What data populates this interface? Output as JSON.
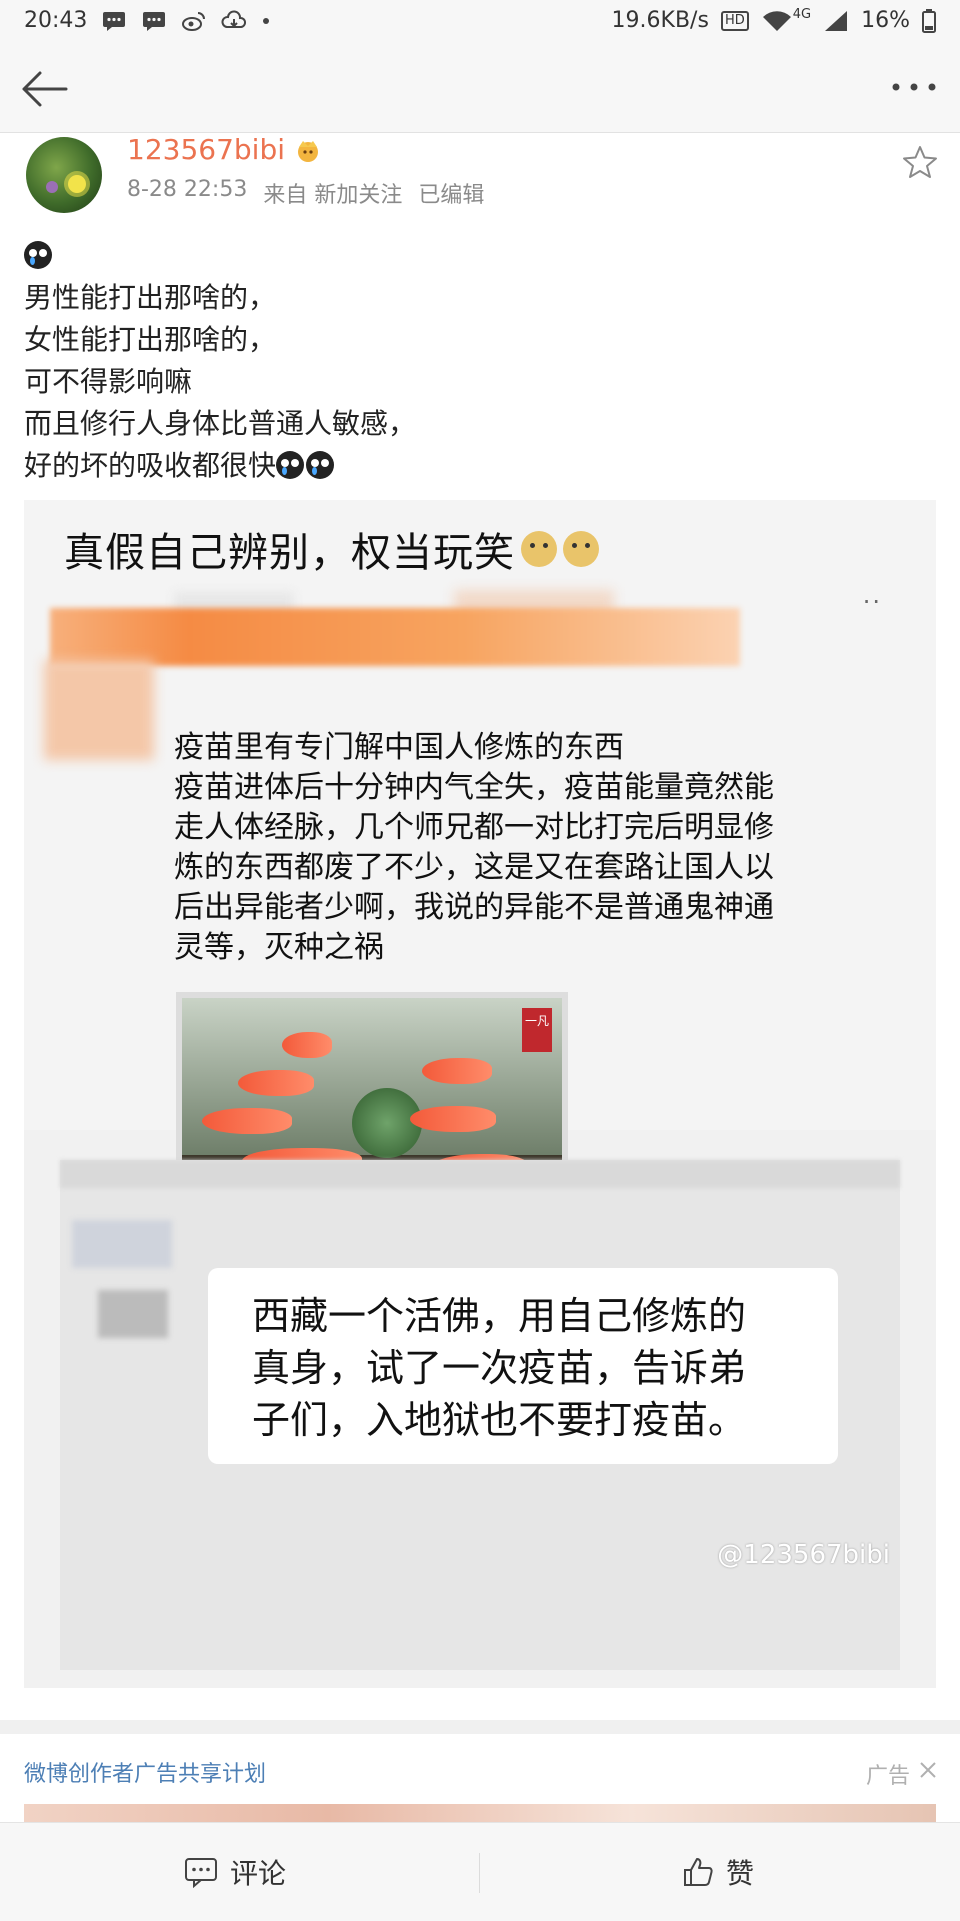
{
  "status_bar": {
    "time": "20:43",
    "net_speed": "19.6KB/s",
    "hd": "HD",
    "network": "4G",
    "battery": "16%"
  },
  "post": {
    "username": "123567bibi",
    "timestamp": "8-28 22:53",
    "source": "来自 新加关注",
    "edited": "已编辑",
    "text_lines": [
      "男性能打出那啥的，",
      "女性能打出那啥的，",
      "可不得影响嘛",
      "而且修行人身体比普通人敏感，",
      "好的坏的吸收都很快"
    ],
    "image": {
      "headline": "真假自己辨别，权当玩笑",
      "dots": "··",
      "message_lines": [
        "疫苗里有专门解中国人修炼的东西",
        "疫苗进体后十分钟内气全失，疫苗能量竟然能",
        "走人体经脉，几个师兄都一对比打完后明显修",
        "炼的东西都废了不少，这是又在套路让国人以",
        "后出异能者少啊，我说的异能不是普通鬼神通",
        "灵等，灭种之祸"
      ],
      "seal_text": "一凡",
      "bubble_lines": [
        "西藏一个活佛，用自己修炼的",
        "真身，试了一次疫苗，告诉弟",
        "子们，入地狱也不要打疫苗。"
      ],
      "watermark": "@123567bibi"
    }
  },
  "ad": {
    "title": "微博创作者广告共享计划",
    "label": "广告"
  },
  "bottom_bar": {
    "comment_label": "评论",
    "like_label": "赞"
  }
}
